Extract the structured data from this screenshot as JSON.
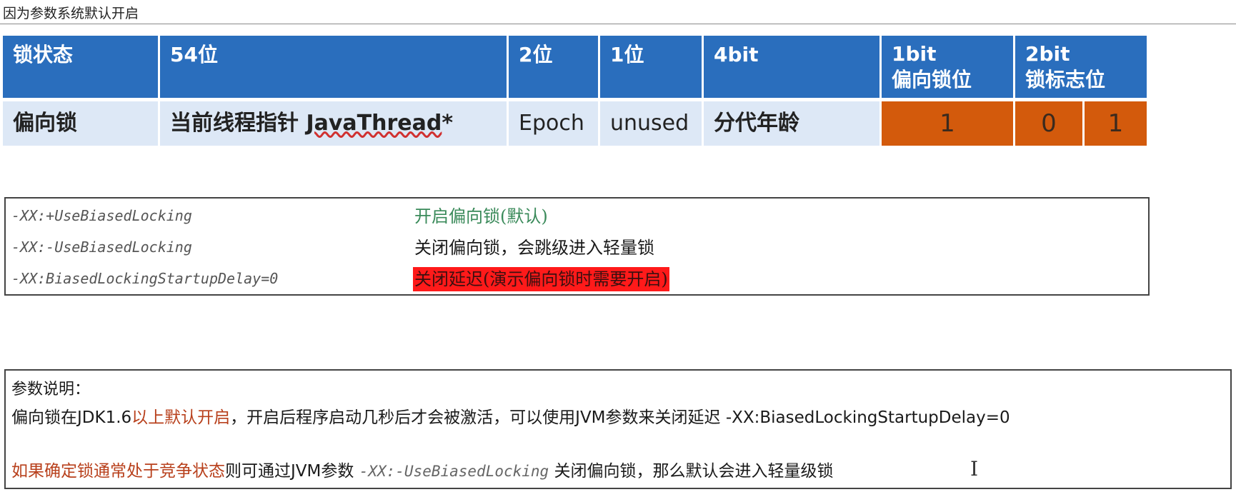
{
  "top": {
    "note": "因为参数系统默认开启"
  },
  "header": [
    "锁状态",
    "54位",
    "2位",
    "1位",
    "4bit",
    "1bit",
    "偏向锁位",
    "2bit",
    "锁标志位"
  ],
  "row": {
    "state": "偏向锁",
    "pointer_prefix": "当前线程指针 ",
    "pointer_type": "JavaThread",
    "pointer_suffix": "*",
    "epoch": "Epoch",
    "unused": "unused",
    "age": "分代年龄",
    "biased_bit": "1",
    "flag_bit1": "0",
    "flag_bit2": "1"
  },
  "params": [
    {
      "name": "-XX:+UseBiasedLocking",
      "desc": "开启偏向锁(默认)"
    },
    {
      "name": "-XX:-UseBiasedLocking",
      "desc": "关闭偏向锁，会跳级进入轻量锁"
    },
    {
      "name": "-XX:BiasedLockingStartupDelay=0",
      "desc": "关闭延迟(演示偏向锁时需要开启)"
    }
  ],
  "explain": {
    "title": "参数说明：",
    "l1_a": "偏向锁在JDK1.6",
    "l1_b": "以上默认开启",
    "l1_c": "，开启后程序启动几秒后才会被激活，可以使用JVM参数来关闭延迟 -XX:BiasedLockingStartupDelay=0",
    "l2_a": "如果确定锁通常处于竞争状态",
    "l2_b": "则可通过JVM参数 ",
    "l2_code": "-XX:-UseBiasedLocking",
    "l2_c": " 关闭偏向锁，那么默认会进入轻量级锁",
    "cursor": "I"
  },
  "colors": {
    "header_blue": "#2a6ebd",
    "row_light": "#dde8f6",
    "bit_orange": "#d35a0c",
    "param_green": "#3a8a5a",
    "highlight_red": "#ff1a1a",
    "text_red": "#b8401c"
  }
}
